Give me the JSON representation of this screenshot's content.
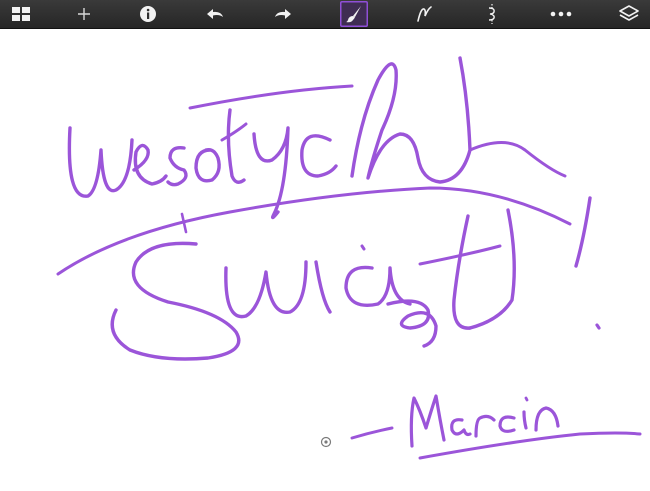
{
  "colors": {
    "toolbar_bg": "#2e2e2e",
    "icon": "#f2f2f2",
    "accent": "#8f4fd6",
    "ink": "#9b55d9",
    "canvas": "#ffffff"
  },
  "toolbar": {
    "items": [
      {
        "name": "grid-view-button",
        "icon": "grid-icon"
      },
      {
        "name": "add-page-button",
        "icon": "plus-icon"
      },
      {
        "name": "info-button",
        "icon": "info-icon"
      },
      {
        "name": "undo-button",
        "icon": "undo-icon"
      },
      {
        "name": "redo-button",
        "icon": "redo-icon"
      },
      {
        "name": "brush-tool-button",
        "icon": "brush-icon",
        "active": true
      },
      {
        "name": "pen-tool-button",
        "icon": "pen-curve-icon"
      },
      {
        "name": "eraser-tool-button",
        "icon": "eraser-icon"
      },
      {
        "name": "more-button",
        "icon": "more-dots-icon"
      },
      {
        "name": "layers-button",
        "icon": "layers-icon"
      }
    ]
  },
  "drawing": {
    "handwritten_words": [
      "Wesołych",
      "Świąt!",
      "—Marcin"
    ]
  }
}
